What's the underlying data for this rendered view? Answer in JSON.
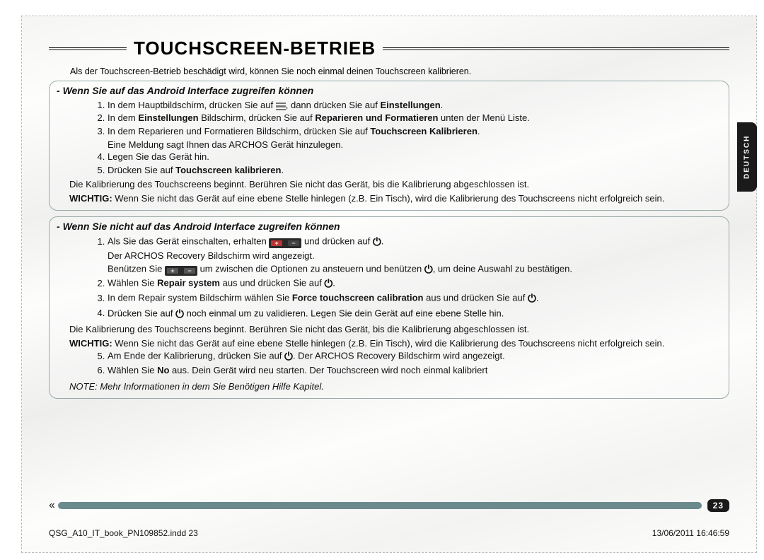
{
  "title": "TOUCHSCREEN-BETRIEB",
  "side_tab": "DEUTSCH",
  "intro": "Als der Touchscreen-Betrieb beschädigt wird, können Sie noch einmal deinen Touchscreen kalibrieren.",
  "section1": {
    "heading_prefix": "- ",
    "heading": "Wenn Sie auf das Android Interface zugreifen können",
    "step1_a": "In dem Hauptbildschirm, drücken Sie auf ",
    "step1_b": ", dann drücken Sie auf ",
    "step1_c": "Einstellungen",
    "step1_d": ".",
    "step2_a": "In dem ",
    "step2_b": "Einstellungen",
    "step2_c": " Bildschirm, drücken Sie auf ",
    "step2_d": "Reparieren und Formatieren",
    "step2_e": " unten der Menü Liste.",
    "step3_a": "In dem Reparieren und Formatieren Bildschirm, drücken Sie auf ",
    "step3_b": "Touchscreen Kalibrieren",
    "step3_c": ".",
    "step3_sub": "Eine Meldung sagt Ihnen das ARCHOS Gerät hinzulegen.",
    "step4": "Legen Sie das Gerät hin.",
    "step5_a": "Drücken Sie auf ",
    "step5_b": "Touchscreen kalibrieren",
    "step5_c": ".",
    "para1": "Die Kalibrierung des Touchscreens beginnt. Berühren Sie nicht das Gerät, bis die Kalibrierung abgeschlossen ist.",
    "para2_a": "WICHTIG:",
    "para2_b": " Wenn Sie nicht das Gerät auf eine ebene Stelle hinlegen (z.B. Ein Tisch), wird die Kalibrierung des Touchscreens nicht erfolgreich sein."
  },
  "section2": {
    "heading_prefix": "- ",
    "heading": "Wenn Sie nicht auf das Android Interface zugreifen können",
    "step1_a": "Als Sie das Gerät einschalten, erhalten ",
    "step1_b": " und drücken auf ",
    "step1_c": ".",
    "step1_sub_a": "Der ARCHOS Recovery Bildschirm wird angezeigt.",
    "step1_sub_b_a": "Benützen Sie ",
    "step1_sub_b_b": " um zwischen die Optionen zu ansteuern und benützen ",
    "step1_sub_b_c": ", um deine Auswahl zu bestätigen.",
    "step2_a": "Wählen Sie ",
    "step2_b": "Repair system",
    "step2_c": " aus und drücken Sie auf ",
    "step2_d": ".",
    "step3_a": "In dem Repair system Bildschirm wählen Sie ",
    "step3_b": "Force touchscreen calibration",
    "step3_c": " aus und drücken Sie auf ",
    "step3_d": ".",
    "step4_a": "Drücken Sie auf ",
    "step4_b": " noch einmal um zu validieren. Legen Sie dein Gerät auf eine ebene Stelle hin.",
    "para1": "Die Kalibrierung des Touchscreens beginnt. Berühren Sie nicht das Gerät, bis die Kalibrierung abgeschlossen ist.",
    "para2_a": "WICHTIG:",
    "para2_b": " Wenn Sie nicht das Gerät auf eine ebene Stelle hinlegen (z.B. Ein Tisch), wird die Kalibrierung des Touchscreens nicht erfolgreich sein.",
    "step5_a": "Am Ende der Kalibrierung, drücken Sie auf ",
    "step5_b": ". Der ARCHOS Recovery Bildschirm wird angezeigt.",
    "step6_a": "Wählen Sie ",
    "step6_b": "No",
    "step6_c": " aus. Dein Gerät wird neu starten. Der Touchscreen wird noch einmal kalibriert",
    "note": "NOTE: Mehr Informationen in dem Sie Benötigen Hilfe Kapitel."
  },
  "page_number": "23",
  "print_left": "QSG_A10_IT_book_PN109852.indd   23",
  "print_right": "13/06/2011   16:46:59"
}
